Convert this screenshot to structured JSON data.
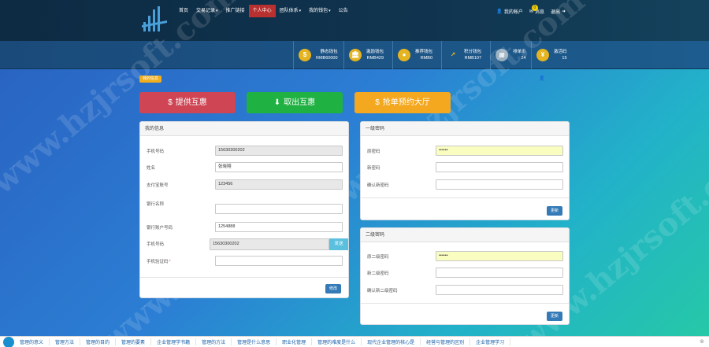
{
  "nav": {
    "items": [
      {
        "label": "首页",
        "caret": false,
        "active": false
      },
      {
        "label": "交易记录",
        "caret": true,
        "active": false
      },
      {
        "label": "推广链接",
        "caret": false,
        "active": false
      },
      {
        "label": "个人中心",
        "caret": false,
        "active": true
      },
      {
        "label": "团队体系",
        "caret": true,
        "active": false
      },
      {
        "label": "我的钱包",
        "caret": true,
        "active": false
      },
      {
        "label": "公告",
        "caret": false,
        "active": false
      }
    ],
    "right": {
      "my_account": "我的帐户",
      "message_badge": "0",
      "message": "消息",
      "logout": "退出"
    }
  },
  "stats": [
    {
      "title": "静态钱包",
      "value": "RMB60000"
    },
    {
      "title": "激励钱包",
      "value": "RMB429"
    },
    {
      "title": "推荐钱包",
      "value": "RMB0"
    },
    {
      "title": "积分钱包",
      "value": "RMB107"
    },
    {
      "title": "排单币",
      "value": "24"
    },
    {
      "title": "激活码",
      "value": "15"
    }
  ],
  "breadcrumb": "我的信息",
  "actions": {
    "provide": "提供互惠",
    "withdraw": "取出互惠",
    "grab": "抢单预约大厅"
  },
  "personal": {
    "title": "我的信息",
    "fields": [
      {
        "label": "手机号码",
        "value": "15630300202"
      },
      {
        "label": "姓名",
        "value": "张晓翔"
      },
      {
        "label": "支付宝账号",
        "value": "123456"
      },
      {
        "label": "银行名称",
        "value": ""
      },
      {
        "label": "银行账户号码",
        "value": "1254888"
      }
    ],
    "phone_label": "手机号码",
    "phone_value": "15630300202",
    "send_button": "发送",
    "code_label": "手机验证码",
    "code_required": "*",
    "submit": "修改"
  },
  "pwd1": {
    "title": "一级密码",
    "old_label": "原密码",
    "old_value": "••••••",
    "new_label": "新密码",
    "confirm_label": "确认新密码",
    "submit": "更新"
  },
  "pwd2": {
    "title": "二级密码",
    "old_label": "原二级密码",
    "old_value": "••••••",
    "new_label": "新二级密码",
    "confirm_label": "确认新二级密码",
    "submit": "更新"
  },
  "watermark": "www.hzjrsoft.com",
  "footer": {
    "links": [
      "管理的意义",
      "管理方法",
      "管理的目的",
      "管理的要素",
      "企业管理学书籍",
      "管理的方法",
      "管理是什么意思",
      "职业化管理",
      "管理的难度是什么",
      "现代企业管理的核心是",
      "经营与管理的区别",
      "企业管理学习"
    ]
  },
  "colors": {
    "nav_bg": "#0d2b43",
    "active": "#b8302f",
    "provide": "#cf4554",
    "withdraw": "#1fb242",
    "grab": "#f4a820",
    "primary": "#337ab7"
  }
}
